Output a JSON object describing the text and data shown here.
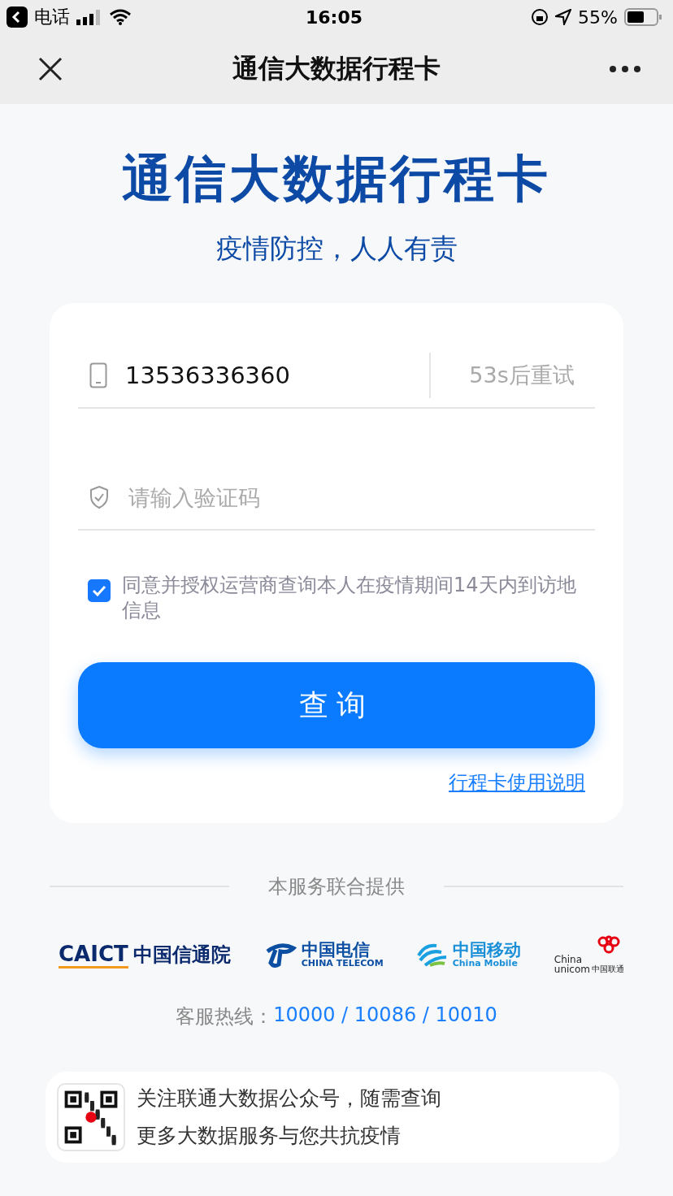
{
  "status_bar": {
    "back_app": "电话",
    "time": "16:05",
    "battery": "55%"
  },
  "nav": {
    "title": "通信大数据行程卡"
  },
  "header": {
    "title": "通信大数据行程卡",
    "slogan": "疫情防控，人人有责"
  },
  "form": {
    "phone": {
      "value": "13536336360"
    },
    "resend": {
      "label": "53s后重试",
      "disabled": true
    },
    "code": {
      "placeholder": "请输入验证码"
    },
    "consent": {
      "text": "同意并授权运营商查询本人在疫情期间14天内到访地信息",
      "checked": true
    },
    "submit": "查询",
    "guide_link": "行程卡使用说明"
  },
  "providers": {
    "label": "本服务联合提供",
    "items": [
      {
        "kind": "caict",
        "texts": [
          "CAICT",
          "中国信通院"
        ]
      },
      {
        "kind": "telecom",
        "texts": [
          "中国电信",
          "CHINA TELECOM"
        ]
      },
      {
        "kind": "mobile",
        "texts": [
          "中国移动",
          "China Mobile"
        ]
      },
      {
        "kind": "unicom",
        "texts": [
          "China",
          "unicom",
          "中国联通"
        ]
      }
    ]
  },
  "hotline": {
    "label": "客服热线：",
    "numbers": "10000 / 10086 / 10010"
  },
  "promo": {
    "lines": [
      "关注联通大数据公众号，随需查询",
      "更多大数据服务与您共抗疫情"
    ]
  }
}
